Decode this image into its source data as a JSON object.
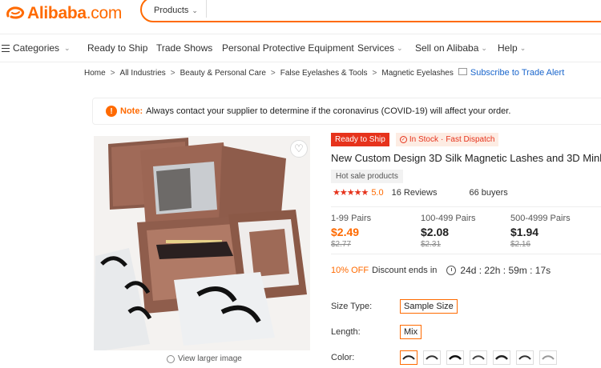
{
  "brand": {
    "logo_text": "Alibaba",
    "logo_suffix": ".com",
    "accent_color": "#ff6a00"
  },
  "search": {
    "category": "Products"
  },
  "nav": {
    "categories": "Categories",
    "items": [
      {
        "label": "Ready to Ship"
      },
      {
        "label": "Trade Shows"
      },
      {
        "label": "Personal Protective Equipment"
      },
      {
        "label": "Services"
      },
      {
        "label": "Sell on Alibaba"
      },
      {
        "label": "Help"
      }
    ]
  },
  "breadcrumb": {
    "items": [
      "Home",
      "All Industries",
      "Beauty & Personal Care",
      "False Eyelashes & Tools",
      "Magnetic Eyelashes"
    ],
    "subscribe": "Subscribe to Trade Alert"
  },
  "note": {
    "label": "Note:",
    "text": "Always contact your supplier to determine if the coronavirus (COVID-19) will affect your order."
  },
  "product": {
    "view_larger": "View larger image",
    "badge_ready": "Ready to Ship",
    "badge_stock": "In Stock",
    "badge_sep": "·",
    "badge_dispatch": "Fast Dispatch",
    "title": "New Custom Design 3D Silk Magnetic Lashes and 3D Mink M",
    "hot_tag": "Hot sale products",
    "rating": "5.0",
    "reviews": "16 Reviews",
    "buyers": "66 buyers"
  },
  "pricing": {
    "tiers": [
      {
        "range": "1-99 Pairs",
        "price": "$2.49",
        "old": "$2.77"
      },
      {
        "range": "100-499 Pairs",
        "price": "$2.08",
        "old": "$2.31"
      },
      {
        "range": "500-4999 Pairs",
        "price": "$1.94",
        "old": "$2.16"
      }
    ]
  },
  "discount": {
    "off": "10% OFF",
    "text": "Discount ends in",
    "countdown": "24d : 22h : 59m : 17s"
  },
  "attributes": {
    "size_type_label": "Size Type:",
    "size_type_value": "Sample Size",
    "length_label": "Length:",
    "length_value": "Mix",
    "color_label": "Color:"
  }
}
